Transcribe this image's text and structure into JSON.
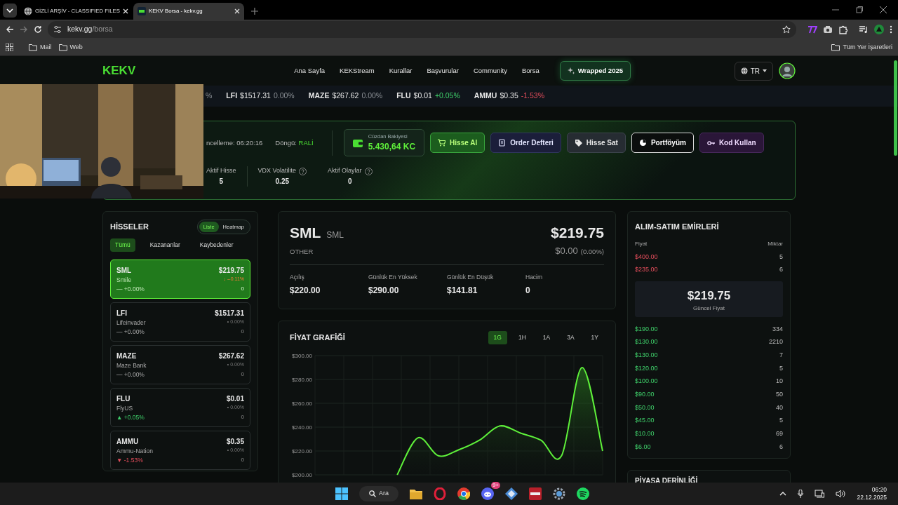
{
  "browser": {
    "tabs": [
      {
        "title": "GİZLİ ARŞİV - CLASSIFIED FILES",
        "selected": false,
        "kind": "globe"
      },
      {
        "title": "KEKV Borsa - kekv.gg",
        "selected": true,
        "kind": "site"
      }
    ],
    "address": {
      "host": "kekv.gg",
      "path": "/borsa"
    },
    "bookmarks": [
      "Mail",
      "Web"
    ],
    "all_bookmarks": "Tüm Yer İşaretleri"
  },
  "nav": {
    "logo": "KEKV",
    "links": [
      {
        "label": "Ana Sayfa",
        "kind": "link"
      },
      {
        "label": "KEKStream",
        "kind": "link"
      },
      {
        "label": "Kurallar",
        "kind": "link"
      },
      {
        "label": "Başvurular",
        "kind": "link"
      },
      {
        "label": "Community",
        "kind": "link"
      },
      {
        "label": "Borsa",
        "kind": "link"
      },
      {
        "label": "Wrapped 2025",
        "kind": "highlight"
      }
    ],
    "language": "TR"
  },
  "ticker": [
    {
      "change": "%"
    },
    {
      "symbol": "LFI",
      "price": "$1517.31",
      "change": "0.00%"
    },
    {
      "symbol": "MAZE",
      "price": "$267.62",
      "change": "0.00%"
    },
    {
      "symbol": "FLU",
      "price": "$0.01",
      "change": "+0.05%",
      "color": "#3fcf6a"
    },
    {
      "symbol": "AMMU",
      "price": "$0.35",
      "change": "-1.53%",
      "color": "#e34d5b"
    }
  ],
  "hero": {
    "update": "ncelleme: 06:20:16",
    "cycle_label": "Döngü:",
    "cycle_value": "RALİ",
    "wallet": {
      "label": "Cüzdan Bakiyesi",
      "value": "5.430,64 KC"
    },
    "actions": [
      {
        "label": "Hisse Al",
        "kind": "buy"
      },
      {
        "label": "Order Defteri",
        "kind": "book"
      },
      {
        "label": "Hisse Sat",
        "kind": "sell"
      },
      {
        "label": "Portföyüm",
        "kind": "portfolio"
      },
      {
        "label": "Kod Kullan",
        "kind": "code"
      }
    ],
    "stats": [
      {
        "label": "Aktif Hisse",
        "value": "5",
        "help": false
      },
      {
        "label": "VDX Volatilite",
        "value": "0.25",
        "help": true
      },
      {
        "label": "Aktif Olaylar",
        "value": "0",
        "help": true
      }
    ]
  },
  "stocks": {
    "title": "HİSSELER",
    "views": [
      {
        "label": "Liste",
        "selected": true
      },
      {
        "label": "Heatmap",
        "selected": false
      }
    ],
    "filters": [
      {
        "label": "Tümü",
        "selected": true
      },
      {
        "label": "Kazananlar",
        "selected": false
      },
      {
        "label": "Kaybedenler",
        "selected": false
      }
    ],
    "items": [
      {
        "symbol": "SML",
        "name": "Smile",
        "price": "$219.75",
        "tick": {
          "sign": "↓",
          "text": "--0.11%"
        },
        "change": {
          "sign": "—",
          "text": "+0.00%"
        },
        "volume": "0",
        "selected": true
      },
      {
        "symbol": "LFI",
        "name": "Lifeinvader",
        "price": "$1517.31",
        "tick": {
          "sign": "•",
          "text": "0.00%"
        },
        "change": {
          "sign": "—",
          "text": "+0.00%"
        },
        "volume": "0",
        "selected": false
      },
      {
        "symbol": "MAZE",
        "name": "Maze Bank",
        "price": "$267.62",
        "tick": {
          "sign": "•",
          "text": "0.00%"
        },
        "change": {
          "sign": "—",
          "text": "+0.00%"
        },
        "volume": "0",
        "selected": false
      },
      {
        "symbol": "FLU",
        "name": "FlyUS",
        "price": "$0.01",
        "tick": {
          "sign": "•",
          "text": "0.00%"
        },
        "change": {
          "sign": "▲",
          "text": "+0.05%",
          "color": "#3fcf6a"
        },
        "volume": "0",
        "selected": false
      },
      {
        "symbol": "AMMU",
        "name": "Ammu-Nation",
        "price": "$0.35",
        "tick": {
          "sign": "•",
          "text": "0.00%"
        },
        "change": {
          "sign": "▼",
          "text": "-1.53%",
          "color": "#e34d5b"
        },
        "volume": "0",
        "selected": false
      }
    ]
  },
  "detail": {
    "symbol": "SML",
    "sub": "SML",
    "category": "OTHER",
    "price": "$219.75",
    "change": "$0.00",
    "percent": "(0.00%)",
    "stats": [
      {
        "label": "Açılış",
        "value": "$220.00"
      },
      {
        "label": "Günlük En Yüksek",
        "value": "$290.00"
      },
      {
        "label": "Günlük En Düşük",
        "value": "$141.81"
      },
      {
        "label": "Hacim",
        "value": "0"
      }
    ]
  },
  "chart": {
    "title": "FİYAT GRAFİĞİ",
    "ranges": [
      {
        "label": "1G",
        "selected": true
      },
      {
        "label": "1H",
        "selected": false
      },
      {
        "label": "1A",
        "selected": false
      },
      {
        "label": "3A",
        "selected": false
      },
      {
        "label": "1Y",
        "selected": false
      }
    ],
    "chart_data": {
      "type": "area",
      "grid": true,
      "series": [
        {
          "color": "#5ef03a",
          "values": [
            null,
            null,
            null,
            null,
            200,
            231,
            216,
            221,
            229,
            241,
            235,
            229,
            216,
            290,
            220
          ]
        }
      ],
      "ylim": [
        200,
        300
      ],
      "yticks": [
        {
          "value": 200,
          "label": "$200.00"
        },
        {
          "value": 220,
          "label": "$220.00"
        },
        {
          "value": 240,
          "label": "$240.00"
        },
        {
          "value": 260,
          "label": "$260.00"
        },
        {
          "value": 280,
          "label": "$280.00"
        },
        {
          "value": 300,
          "label": "$300.00"
        }
      ]
    }
  },
  "orders": {
    "title": "ALIM-SATIM EMİRLERİ",
    "columns": [
      "Fiyat",
      "Miktar"
    ],
    "asks": [
      {
        "price": "$400.00",
        "amount": "5"
      },
      {
        "price": "$235.00",
        "amount": "6"
      }
    ],
    "current": {
      "price": "$219.75",
      "label": "Güncel Fiyat"
    },
    "bids": [
      {
        "price": "$190.00",
        "amount": "334"
      },
      {
        "price": "$130.00",
        "amount": "2210"
      },
      {
        "price": "$130.00",
        "amount": "7"
      },
      {
        "price": "$120.00",
        "amount": "5"
      },
      {
        "price": "$100.00",
        "amount": "10"
      },
      {
        "price": "$90.00",
        "amount": "50"
      },
      {
        "price": "$50.00",
        "amount": "40"
      },
      {
        "price": "$45.00",
        "amount": "5"
      },
      {
        "price": "$10.00",
        "amount": "69"
      },
      {
        "price": "$6.00",
        "amount": "6"
      }
    ]
  },
  "depth": {
    "title": "PİYASA DERİNLİĞİ"
  },
  "taskbar": {
    "search": "Ara",
    "badge": "9+",
    "time": "06:20",
    "date": "22.12.2025"
  }
}
